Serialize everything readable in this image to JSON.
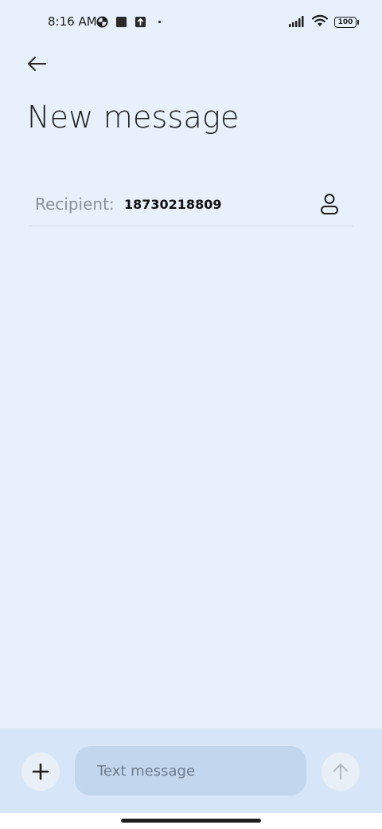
{
  "status_bar": {
    "time": "8:16 AM",
    "battery": "100",
    "icons": [
      "data-saver-icon",
      "square-notification-icon",
      "upload-notification-icon",
      "dot-icon",
      "signal-icon",
      "wifi-icon",
      "battery-icon"
    ]
  },
  "header": {
    "title": "New message",
    "back_icon": "arrow-left-icon"
  },
  "recipient": {
    "label": "Recipient:",
    "value": "18730218809",
    "contact_icon": "person-icon"
  },
  "compose": {
    "placeholder": "Text message",
    "value": "",
    "add_icon": "plus-icon",
    "send_icon": "arrow-up-icon"
  },
  "colors": {
    "background": "#e7f0fb",
    "compose_bar": "#d6e6f8",
    "input_fill": "#c2d6ee"
  }
}
